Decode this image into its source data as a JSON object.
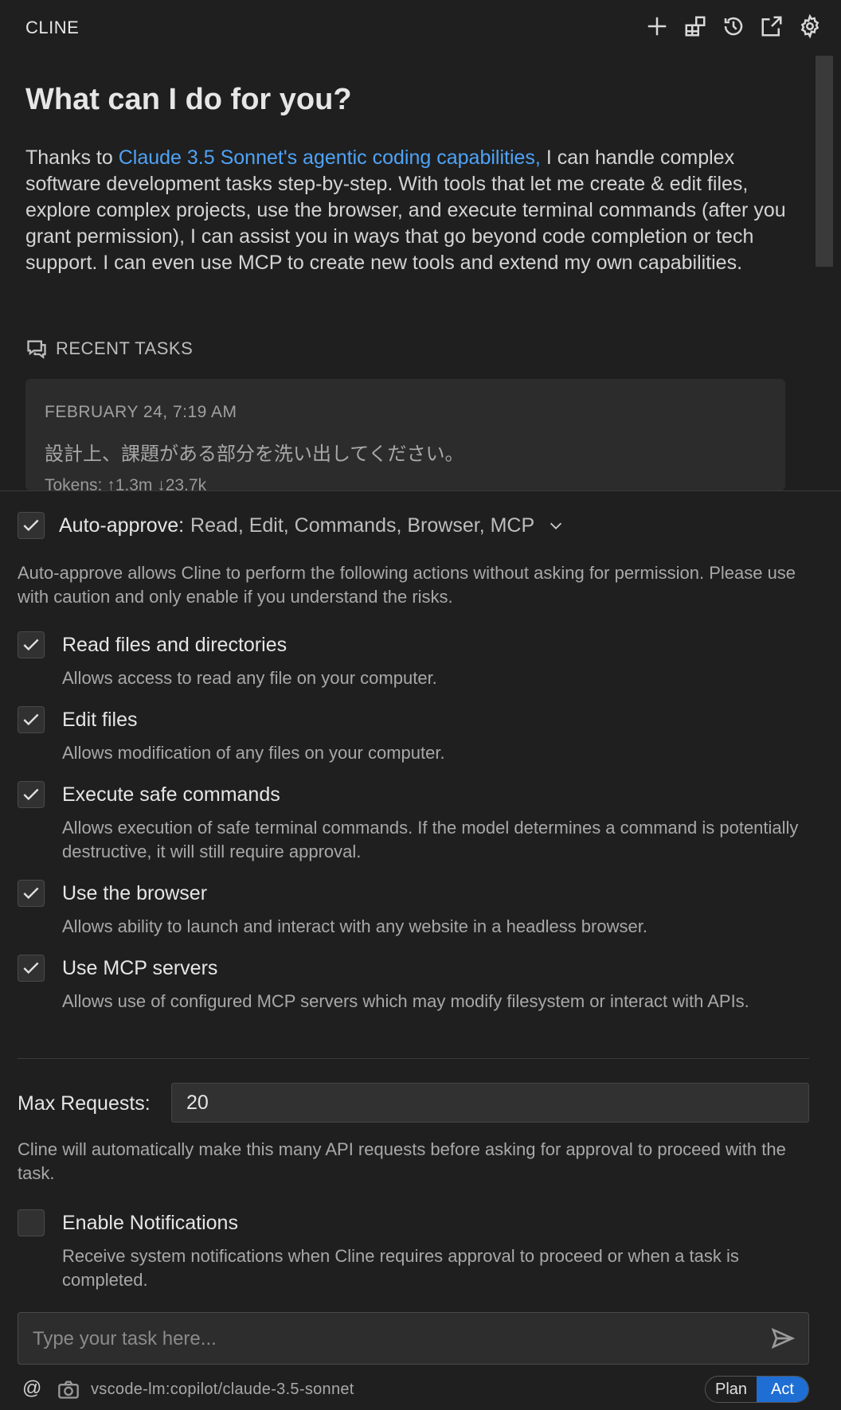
{
  "header": {
    "title": "CLINE",
    "icons": [
      "plus-icon",
      "mcp-servers-icon",
      "history-icon",
      "popout-icon",
      "gear-icon"
    ]
  },
  "welcome": {
    "title": "What can I do for you?",
    "text_prefix": "Thanks to ",
    "link_text": "Claude 3.5 Sonnet's agentic coding capabilities,",
    "text_suffix": " I can handle complex software development tasks step-by-step. With tools that let me create & edit files, explore complex projects, use the browser, and execute terminal commands (after you grant permission), I can assist you in ways that go beyond code completion or tech support. I can even use MCP to create new tools and extend my own capabilities."
  },
  "recent": {
    "header": "RECENT TASKS",
    "task": {
      "date": "FEBRUARY 24, 7:19 AM",
      "text": "設計上、課題がある部分を洗い出してください。",
      "tokens": "Tokens: ↑1.3m ↓23.7k"
    }
  },
  "auto_approve": {
    "label": "Auto-approve:",
    "actions": "Read, Edit, Commands, Browser, MCP",
    "description": "Auto-approve allows Cline to perform the following actions without asking for permission. Please use with caution and only enable if you understand the risks.",
    "options": [
      {
        "label": "Read files and directories",
        "desc": "Allows access to read any file on your computer.",
        "checked": true
      },
      {
        "label": "Edit files",
        "desc": "Allows modification of any files on your computer.",
        "checked": true
      },
      {
        "label": "Execute safe commands",
        "desc": "Allows execution of safe terminal commands. If the model determines a command is potentially destructive, it will still require approval.",
        "checked": true
      },
      {
        "label": "Use the browser",
        "desc": "Allows ability to launch and interact with any website in a headless browser.",
        "checked": true
      },
      {
        "label": "Use MCP servers",
        "desc": "Allows use of configured MCP servers which may modify filesystem or interact with APIs.",
        "checked": true
      }
    ],
    "max_requests": {
      "label": "Max Requests:",
      "value": "20",
      "description": "Cline will automatically make this many API requests before asking for approval to proceed with the task."
    },
    "notifications": {
      "label": "Enable Notifications",
      "desc": "Receive system notifications when Cline requires approval to proceed or when a task is completed.",
      "checked": false
    }
  },
  "input": {
    "placeholder": "Type your task here...",
    "value": ""
  },
  "footer": {
    "at_symbol": "@",
    "model": "vscode-lm:copilot/claude-3.5-sonnet",
    "mode_plan": "Plan",
    "mode_act": "Act",
    "active_mode": "Act"
  },
  "colors": {
    "background": "#1f1f1f",
    "link": "#4fa3f7",
    "accent": "#1f6ed4"
  }
}
